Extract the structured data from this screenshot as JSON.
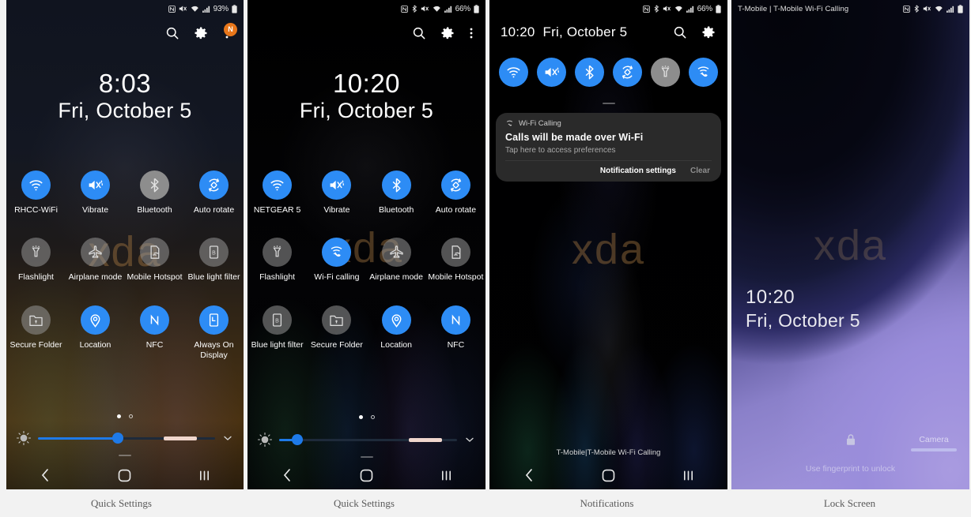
{
  "panels": [
    {
      "caption": "Quick Settings",
      "status": {
        "icons": [
          "nfc-icon",
          "mute-icon",
          "wifi-icon",
          "signal-icon"
        ],
        "battery": "93%"
      },
      "header": {
        "search": "search-icon",
        "settings": "gear-icon",
        "overflow": "overflow-menu-icon",
        "badge": "N"
      },
      "clock": {
        "time": "8:03",
        "date": "Fri, October 5"
      },
      "watermark": "xda",
      "tiles": [
        {
          "label": "RHCC-WiFi",
          "icon": "wifi-icon",
          "state": "on"
        },
        {
          "label": "Vibrate",
          "icon": "vibrate-icon",
          "state": "on"
        },
        {
          "label": "Bluetooth",
          "icon": "bluetooth-icon",
          "state": "off"
        },
        {
          "label": "Auto rotate",
          "icon": "auto-rotate-icon",
          "state": "on"
        },
        {
          "label": "Flashlight",
          "icon": "flashlight-icon",
          "state": "off"
        },
        {
          "label": "Airplane mode",
          "icon": "airplane-icon",
          "state": "off"
        },
        {
          "label": "Mobile Hotspot",
          "icon": "hotspot-icon",
          "state": "off"
        },
        {
          "label": "Blue light filter",
          "icon": "blue-light-icon",
          "state": "off"
        },
        {
          "label": "Secure Folder",
          "icon": "secure-folder-icon",
          "state": "off"
        },
        {
          "label": "Location",
          "icon": "location-icon",
          "state": "on"
        },
        {
          "label": "NFC",
          "icon": "nfc-icon",
          "state": "on"
        },
        {
          "label": "Always On Display",
          "icon": "always-on-display-icon",
          "state": "on"
        }
      ],
      "brightness": {
        "percent": 45,
        "auto_marker": true,
        "page": 1,
        "pages": 2
      },
      "nav": [
        "back-icon",
        "home-icon",
        "recents-icon"
      ]
    },
    {
      "caption": "Quick Settings",
      "status": {
        "icons": [
          "nfc-icon",
          "bluetooth-icon",
          "mute-icon",
          "wifi-icon",
          "signal-icon"
        ],
        "battery": "66%"
      },
      "header": {
        "search": "search-icon",
        "settings": "gear-icon",
        "overflow": "overflow-menu-icon",
        "badge": ""
      },
      "clock": {
        "time": "10:20",
        "date": "Fri, October 5"
      },
      "watermark": "xda",
      "tiles": [
        {
          "label": "NETGEAR 5",
          "icon": "wifi-icon",
          "state": "on"
        },
        {
          "label": "Vibrate",
          "icon": "vibrate-icon",
          "state": "on"
        },
        {
          "label": "Bluetooth",
          "icon": "bluetooth-icon",
          "state": "on"
        },
        {
          "label": "Auto rotate",
          "icon": "auto-rotate-icon",
          "state": "on"
        },
        {
          "label": "Flashlight",
          "icon": "flashlight-icon",
          "state": "off"
        },
        {
          "label": "Wi-Fi calling",
          "icon": "wifi-calling-icon",
          "state": "on"
        },
        {
          "label": "Airplane mode",
          "icon": "airplane-icon",
          "state": "off"
        },
        {
          "label": "Mobile Hotspot",
          "icon": "hotspot-icon",
          "state": "off"
        },
        {
          "label": "Blue light filter",
          "icon": "blue-light-icon",
          "state": "off"
        },
        {
          "label": "Secure Folder",
          "icon": "secure-folder-icon",
          "state": "off"
        },
        {
          "label": "Location",
          "icon": "location-icon",
          "state": "on"
        },
        {
          "label": "NFC",
          "icon": "nfc-icon",
          "state": "on"
        }
      ],
      "brightness": {
        "percent": 10,
        "auto_marker": true,
        "page": 1,
        "pages": 2
      },
      "nav": [
        "back-icon",
        "home-icon",
        "recents-icon"
      ]
    },
    {
      "caption": "Notifications",
      "status": {
        "icons": [
          "nfc-icon",
          "bluetooth-icon",
          "mute-icon",
          "wifi-icon",
          "signal-icon"
        ],
        "battery": "66%"
      },
      "header": {
        "time": "10:20",
        "date": "Fri, October 5",
        "search": "search-icon",
        "settings": "gear-icon"
      },
      "quick_toggles": [
        {
          "icon": "wifi-icon",
          "state": "on"
        },
        {
          "icon": "vibrate-icon",
          "state": "on"
        },
        {
          "icon": "bluetooth-icon",
          "state": "on"
        },
        {
          "icon": "auto-rotate-icon",
          "state": "on"
        },
        {
          "icon": "flashlight-icon",
          "state": "off"
        },
        {
          "icon": "wifi-calling-icon",
          "state": "on"
        }
      ],
      "watermark": "xda",
      "notification": {
        "app": "Wi-Fi Calling",
        "app_icon": "wifi-calling-icon",
        "title": "Calls will be made over Wi-Fi",
        "body": "Tap here to access preferences",
        "action_primary": "Notification settings",
        "action_secondary": "Clear"
      },
      "carrier_line": "T-Mobile|T-Mobile Wi-Fi Calling",
      "nav": [
        "back-icon",
        "home-icon",
        "recents-icon"
      ]
    },
    {
      "caption": "Lock Screen",
      "status": {
        "carrier": "T-Mobile | T-Mobile Wi-Fi Calling",
        "icons": [
          "nfc-icon",
          "bluetooth-icon",
          "mute-icon",
          "wifi-icon",
          "signal-icon"
        ],
        "battery": ""
      },
      "watermark": "xda",
      "clock": {
        "time": "10:20",
        "date": "Fri, October 5"
      },
      "lock_icon": "lock-icon",
      "hint": "Use fingerprint to unlock",
      "camera_label": "Camera"
    }
  ],
  "colors": {
    "accent_on": "#2d8cf5",
    "toggle_off": "#8d8d8d",
    "badge": "#e8761a",
    "slider": "#1e7ae8"
  }
}
